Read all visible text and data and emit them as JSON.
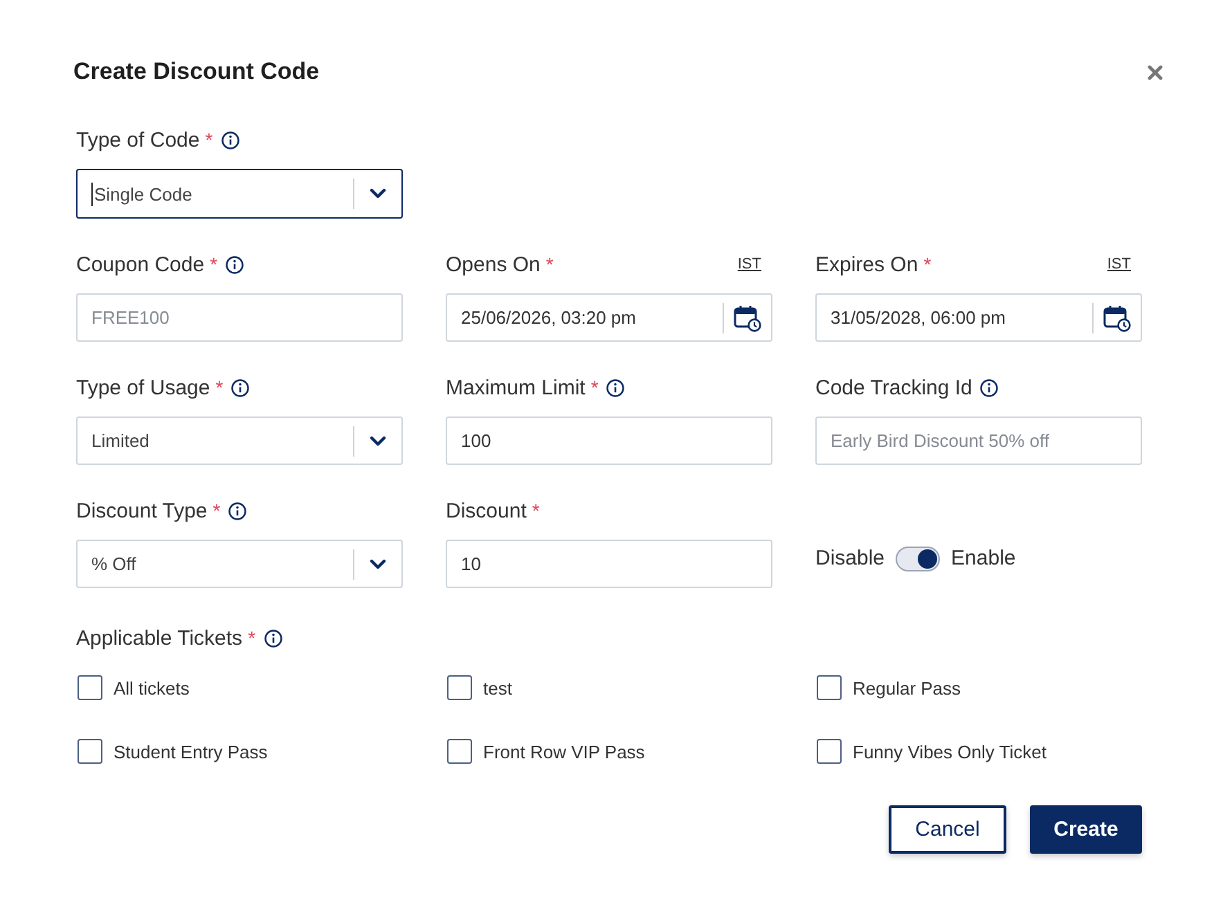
{
  "dialog": {
    "title": "Create Discount Code"
  },
  "rows": [
    [
      {
        "kind": "select",
        "label": "Type of Code",
        "mark": "*",
        "info": true,
        "value": "Single Code",
        "focused": true
      }
    ],
    [
      {
        "kind": "text",
        "label": "Coupon Code",
        "mark": "*",
        "info": true,
        "placeholder": "FREE100"
      },
      {
        "kind": "datetime",
        "label": "Opens On",
        "mark": "*",
        "timezone": "IST",
        "value": "25/06/2026, 03:20 pm"
      },
      {
        "kind": "datetime",
        "label": "Expires On",
        "mark": "*",
        "timezone": "IST",
        "value": "31/05/2028, 06:00 pm"
      }
    ],
    [
      {
        "kind": "select",
        "label": "Type of Usage",
        "mark": "*",
        "info": true,
        "value": "Limited",
        "focused": false
      },
      {
        "kind": "text",
        "label": "Maximum Limit",
        "mark": "*",
        "info": true,
        "value": "100"
      },
      {
        "kind": "text",
        "label": "Code Tracking Id",
        "info": true,
        "placeholder": "Early Bird Discount 50% off"
      }
    ],
    [
      {
        "kind": "select",
        "label": "Discount Type",
        "mark": "*",
        "info": true,
        "value": "% Off",
        "focused": false
      },
      {
        "kind": "text",
        "label": "Discount",
        "mark": "*",
        "value": "10"
      },
      {
        "kind": "toggle",
        "off_label": "Disable",
        "on_label": "Enable",
        "on": true
      }
    ]
  ],
  "tickets": {
    "label": "Applicable Tickets",
    "mark": "*",
    "info": true,
    "options": [
      {
        "label": "All tickets",
        "checked": false
      },
      {
        "label": "test",
        "checked": false
      },
      {
        "label": "Regular Pass",
        "checked": false
      },
      {
        "label": "Student Entry Pass",
        "checked": false
      },
      {
        "label": "Front Row VIP Pass",
        "checked": false
      },
      {
        "label": "Funny Vibes Only Ticket",
        "checked": false
      }
    ]
  },
  "buttons": [
    {
      "kind": "secondary",
      "label": "Cancel"
    },
    {
      "kind": "primary",
      "label": "Create"
    }
  ]
}
